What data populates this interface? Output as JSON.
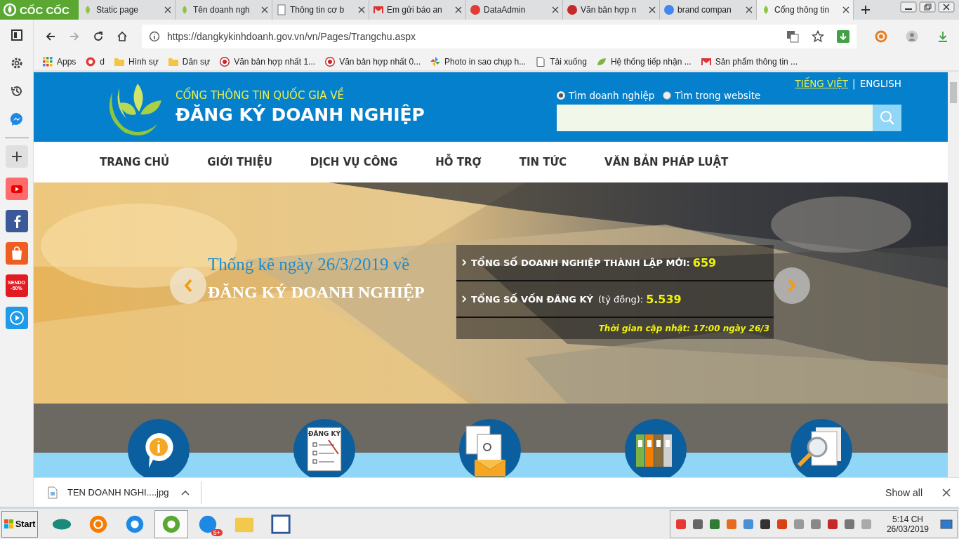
{
  "browser": {
    "brand": "CỐC CỐC",
    "tabs": [
      {
        "title": "Static page",
        "selected": false
      },
      {
        "title": "Tên doanh ngh",
        "selected": false
      },
      {
        "title": "Thông tin cơ b",
        "selected": false
      },
      {
        "title": "Em gửi báo an",
        "selected": false
      },
      {
        "title": "DataAdmin",
        "selected": false
      },
      {
        "title": "Văn bản hợp n",
        "selected": false
      },
      {
        "title": "brand compan",
        "selected": false
      },
      {
        "title": "Cổng thông tin",
        "selected": true
      }
    ],
    "url": "https://dangkykinhdoanh.gov.vn/vn/Pages/Trangchu.aspx",
    "bookmarks": [
      "Apps",
      "d",
      "Hình sự",
      "Dân sự",
      "Văn bản hợp nhất 1...",
      "Văn bản hợp nhất 0...",
      "Photo in sao chụp h...",
      "Tải xuống",
      "Hệ thống tiếp nhận ...",
      "Sản phẩm thông tin ..."
    ],
    "sidebar": [
      {
        "kind": "panel"
      },
      {
        "kind": "settings"
      },
      {
        "kind": "history"
      },
      {
        "kind": "messenger"
      },
      {
        "kind": "add"
      },
      {
        "kind": "youtube"
      },
      {
        "kind": "facebook"
      },
      {
        "kind": "shopee"
      },
      {
        "kind": "sendo",
        "text": "SENDO -50%"
      },
      {
        "kind": "player"
      }
    ]
  },
  "page": {
    "header": {
      "subtitle": "CỔNG THÔNG TIN QUỐC GIA VỀ",
      "title": "ĐĂNG KÝ DOANH NGHIỆP",
      "languages": [
        {
          "label": "TIẾNG VIỆT",
          "selected": true
        },
        {
          "label": "ENGLISH",
          "selected": false
        }
      ],
      "separator": "|",
      "search_modes": [
        {
          "label": "Tìm doanh nghiệp",
          "selected": true
        },
        {
          "label": "Tìm trong website",
          "selected": false
        }
      ]
    },
    "nav": [
      "TRANG CHỦ",
      "GIỚI THIỆU",
      "DỊCH VỤ CÔNG",
      "HỖ TRỢ",
      "TIN TỨC",
      "VĂN BẢN PHÁP LUẬT"
    ],
    "hero": {
      "intro": "Thống kê ngày 26/3/2019 về",
      "headline": "ĐĂNG KÝ DOANH NGHIỆP",
      "stats": [
        {
          "label": "TỔNG SỐ DOANH NGHIỆP THÀNH LẬP MỚI:",
          "value": "659"
        },
        {
          "label": "TỔNG SỐ VỐN ĐĂNG KÝ",
          "unit": "(tỷ đồng):",
          "value": "5.539"
        }
      ],
      "updated": "Thời gian cập nhật: 17:00 ngày 26/3"
    },
    "services": [
      {
        "kind": "info"
      },
      {
        "kind": "checklist",
        "text": "ĐĂNG KÝ"
      },
      {
        "kind": "mail"
      },
      {
        "kind": "binders"
      },
      {
        "kind": "magnifier"
      }
    ]
  },
  "downloads": {
    "file": "TEN DOANH NGHI....jpg",
    "show_all": "Show all"
  },
  "taskbar": {
    "start": "Start",
    "apps": [
      {
        "kind": "viettel",
        "selected": false
      },
      {
        "kind": "wheel",
        "selected": false
      },
      {
        "kind": "ie",
        "selected": false
      },
      {
        "kind": "coccoc",
        "selected": true
      },
      {
        "kind": "zalo",
        "badge": "5+",
        "selected": false
      },
      {
        "kind": "explorer",
        "selected": false
      },
      {
        "kind": "word",
        "selected": false
      }
    ],
    "time": "5:14 CH",
    "date": "26/03/2019"
  }
}
